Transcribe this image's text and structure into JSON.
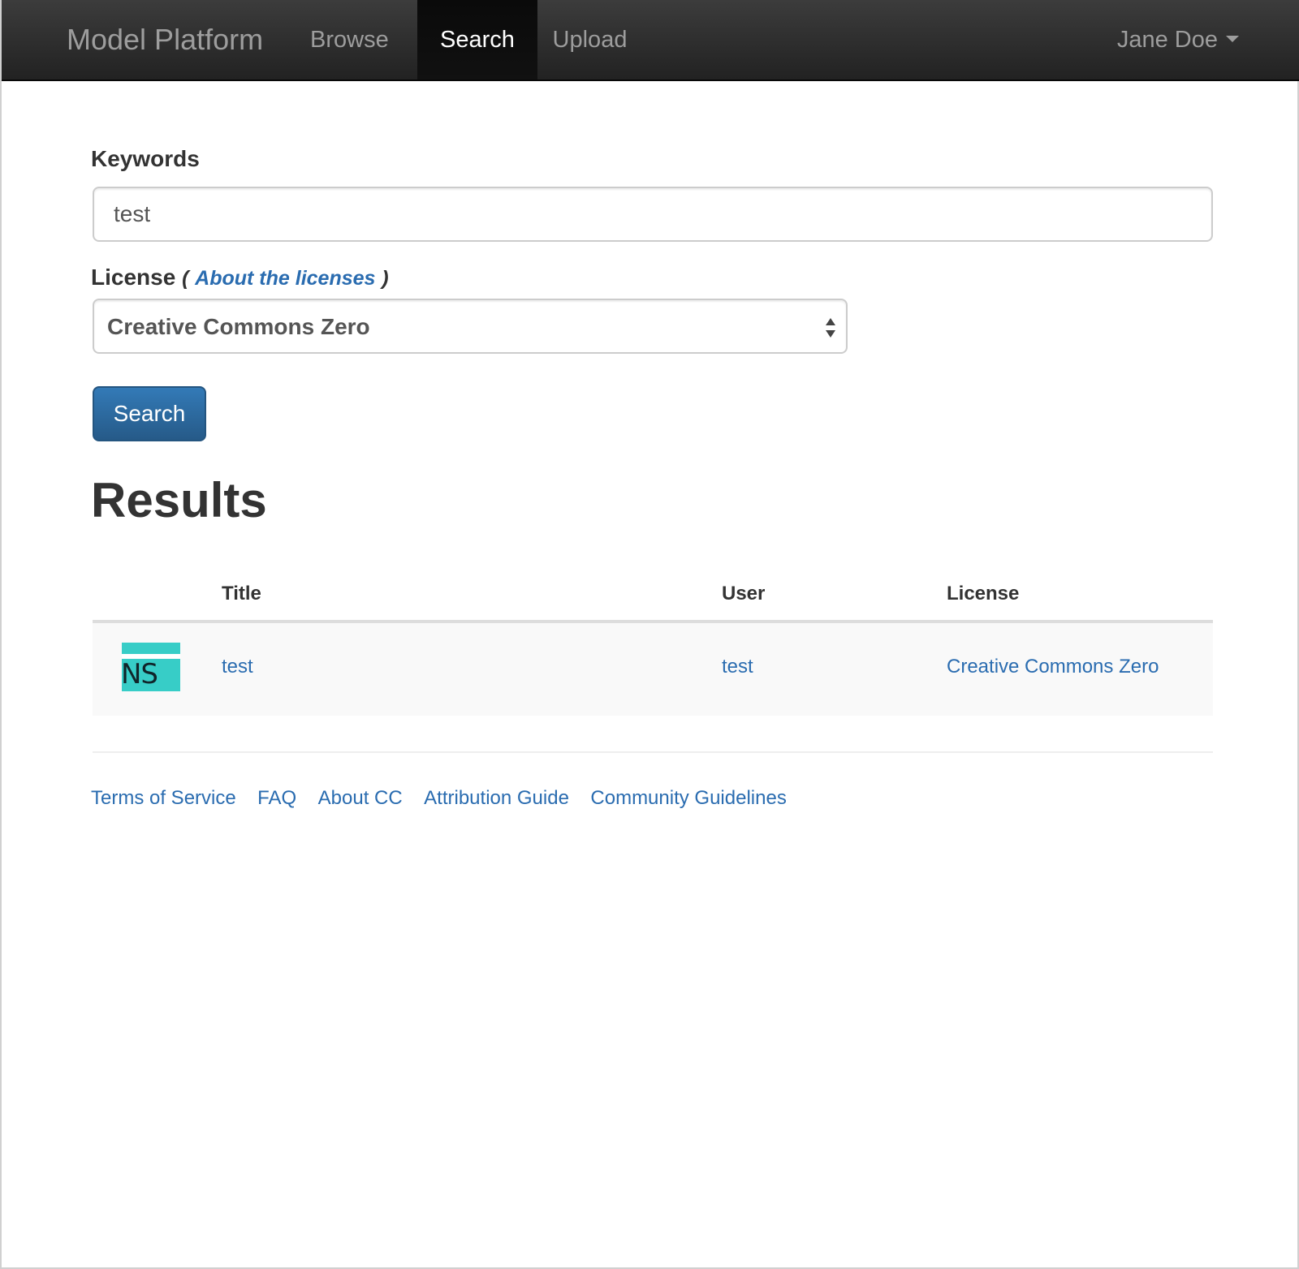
{
  "navbar": {
    "brand": "Model Platform",
    "items": [
      {
        "label": "Browse",
        "active": false
      },
      {
        "label": "Search",
        "active": true
      },
      {
        "label": "Upload",
        "active": false
      }
    ],
    "user": "Jane Doe"
  },
  "form": {
    "keywords_label": "Keywords",
    "keywords_value": "test",
    "license_label": "License",
    "about_licenses_link": "About the licenses",
    "paren_open": "(",
    "paren_close": ")",
    "license_selected": "Creative Commons Zero",
    "search_button": "Search"
  },
  "results": {
    "heading": "Results",
    "columns": [
      "Title",
      "User",
      "License"
    ],
    "rows": [
      {
        "thumbnail_text": "NS",
        "title": "test",
        "user": "test",
        "license": "Creative Commons Zero"
      }
    ]
  },
  "footer": {
    "links": [
      "Terms of Service",
      "FAQ",
      "About CC",
      "Attribution Guide",
      "Community Guidelines"
    ]
  },
  "colors": {
    "navbar_bg": "#222222",
    "link": "#2a6cb0",
    "primary_button": "#337ab7",
    "thumbnail_accent": "#37cdc7"
  }
}
